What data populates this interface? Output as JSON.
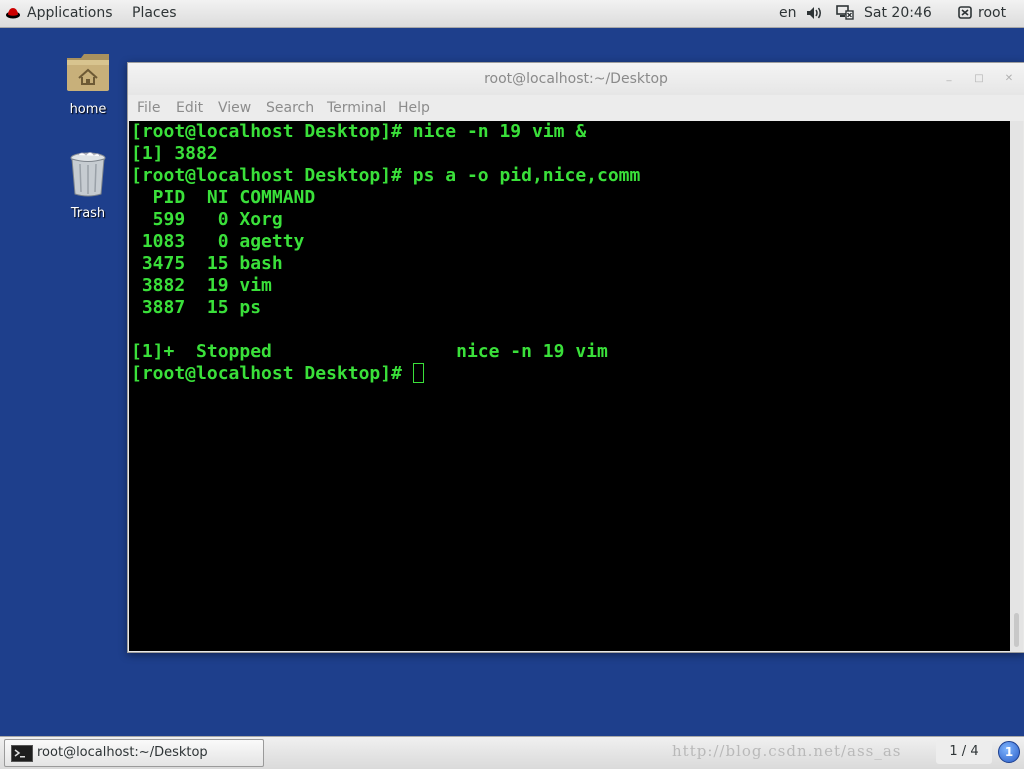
{
  "top_panel": {
    "applications": "Applications",
    "places": "Places",
    "language": "en",
    "clock": "Sat 20:46",
    "user": "root",
    "icons": [
      "redhat-logo",
      "volume-icon",
      "network-icon",
      "user-icon"
    ]
  },
  "desktop": {
    "icons": [
      {
        "label": "home",
        "icon": "home-folder-icon"
      },
      {
        "label": "Trash",
        "icon": "trash-icon"
      }
    ]
  },
  "terminal_window": {
    "title": "root@localhost:~/Desktop",
    "menu": [
      "File",
      "Edit",
      "View",
      "Search",
      "Terminal",
      "Help"
    ],
    "lines": [
      "[root@localhost Desktop]# nice -n 19 vim &",
      "[1] 3882",
      "[root@localhost Desktop]# ps a -o pid,nice,comm",
      "  PID  NI COMMAND",
      "  599   0 Xorg",
      " 1083   0 agetty",
      " 3475  15 bash",
      " 3882  19 vim",
      " 3887  15 ps",
      "",
      "[1]+  Stopped                 nice -n 19 vim",
      "[root@localhost Desktop]# "
    ],
    "text_color": "#3ae03a",
    "background_color": "#000000"
  },
  "bottom_panel": {
    "task_label": "root@localhost:~/Desktop",
    "watermark": "http://blog.csdn.net/ass_as",
    "workspace": "1 / 4",
    "notification_count": "1"
  },
  "colors": {
    "desktop_bg": "#1e3f8c",
    "panel_bg": "#e6e6e6"
  }
}
